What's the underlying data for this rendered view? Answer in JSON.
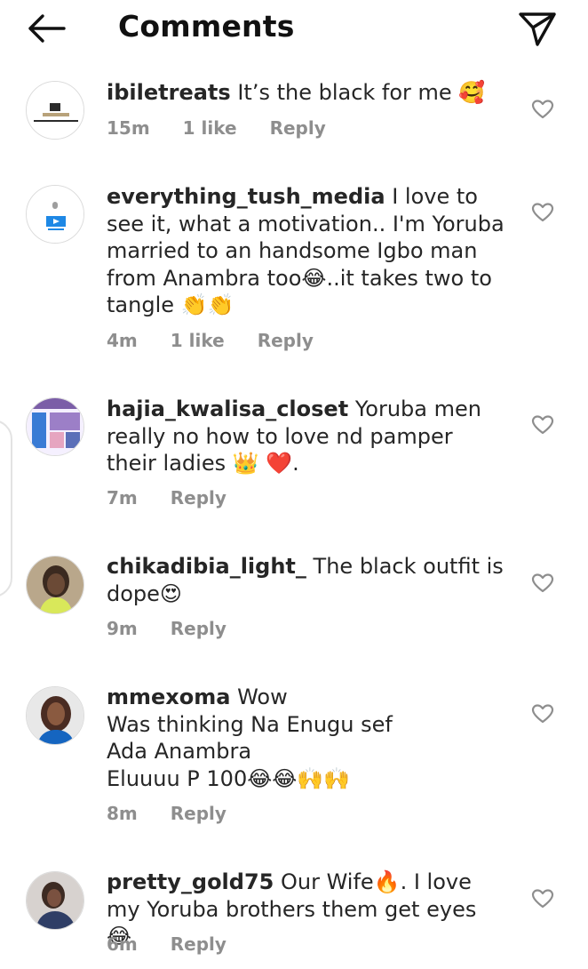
{
  "header": {
    "title": "Comments",
    "back_icon": "arrow-left-icon",
    "send_icon": "paper-plane-icon"
  },
  "comments": [
    {
      "username": "ibiletreats",
      "text": "It’s the black for me 🥰",
      "time": "15m",
      "likes": "1 like",
      "reply": "Reply",
      "avatar_colors": [
        "#ffffff",
        "#2b2b2b",
        "#b8a27a"
      ]
    },
    {
      "username": "everything_tush_media",
      "text": "I love to see it, what a motivation.. I'm Yoruba married to an handsome Igbo man from Anambra too😂..it takes two to tangle 👏👏",
      "time": "4m",
      "likes": "1 like",
      "reply": "Reply",
      "avatar_colors": [
        "#ffffff",
        "#1e88e5",
        "#9e9e9e"
      ]
    },
    {
      "username": "hajia_kwalisa_closet",
      "text": "Yoruba men really no how to love nd pamper their ladies 👑 ❤️.",
      "time": "7m",
      "likes": "",
      "reply": "Reply",
      "avatar_colors": [
        "#f5f0ff",
        "#7b5ea7",
        "#3a7bd5"
      ]
    },
    {
      "username": "chikadibia_light_",
      "text": "The black outfit is dope😍",
      "time": "9m",
      "likes": "",
      "reply": "Reply",
      "avatar_colors": [
        "#b9a78b",
        "#3b2a20",
        "#d9e85a"
      ]
    },
    {
      "username": "mmexoma",
      "text": "Wow\nWas thinking Na Enugu sef\nAda Anambra\nEluuuu P 100😂😂🙌🙌",
      "time": "8m",
      "likes": "",
      "reply": "Reply",
      "avatar_colors": [
        "#e8e8e8",
        "#4a2c22",
        "#1565c0"
      ]
    },
    {
      "username": "pretty_gold75",
      "text": "Our Wife🔥. I love my Yoruba brothers them get eyes 😂",
      "time": "6m",
      "likes": "",
      "reply": "Reply",
      "avatar_colors": [
        "#d7d2cf",
        "#3d2b23",
        "#2f3e66"
      ]
    }
  ],
  "heart_icon": "heart-outline-icon"
}
